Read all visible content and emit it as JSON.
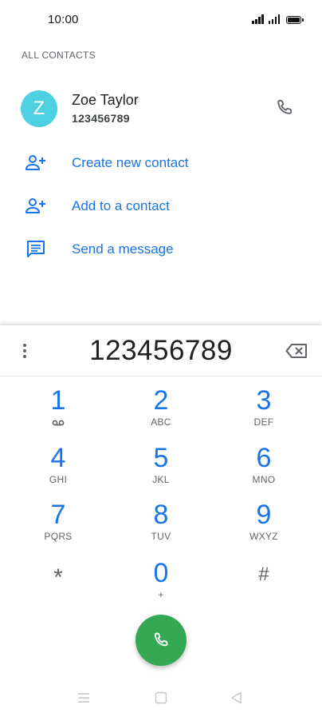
{
  "status_bar": {
    "time": "10:00",
    "icons": [
      "signal-icon",
      "signal-icon",
      "battery-icon"
    ]
  },
  "contacts": {
    "section_header": "ALL CONTACTS",
    "contact": {
      "avatar_letter": "Z",
      "avatar_color": "#4dd0e1",
      "name": "Zoe Taylor",
      "number": "123456789"
    }
  },
  "actions": [
    {
      "label": "Create new contact",
      "icon": "add-person-icon"
    },
    {
      "label": "Add to a contact",
      "icon": "add-person-icon"
    },
    {
      "label": "Send a message",
      "icon": "message-icon"
    }
  ],
  "dialpad": {
    "entered_digits": "123456789",
    "keys": [
      {
        "digit": "1",
        "letters": ""
      },
      {
        "digit": "2",
        "letters": "ABC"
      },
      {
        "digit": "3",
        "letters": "DEF"
      },
      {
        "digit": "4",
        "letters": "GHI"
      },
      {
        "digit": "5",
        "letters": "JKL"
      },
      {
        "digit": "6",
        "letters": "MNO"
      },
      {
        "digit": "7",
        "letters": "PQRS"
      },
      {
        "digit": "8",
        "letters": "TUV"
      },
      {
        "digit": "9",
        "letters": "WXYZ"
      },
      {
        "digit": "*",
        "letters": ""
      },
      {
        "digit": "0",
        "letters": "+"
      },
      {
        "digit": "#",
        "letters": ""
      }
    ]
  },
  "colors": {
    "accent": "#1a73e8",
    "call_button": "#34a853"
  }
}
